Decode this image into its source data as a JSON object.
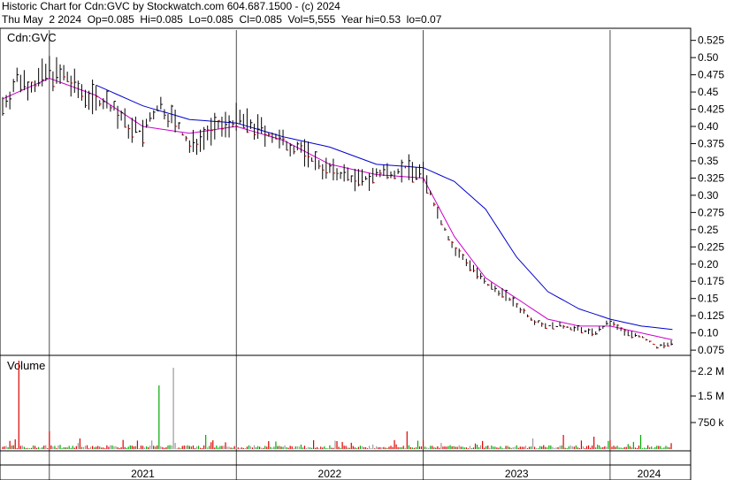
{
  "header": {
    "line1": "Historic Chart for Cdn:GVC by Stockwatch.com 604.687.1500 - (c) 2024",
    "line2": "Thu May  2 2024  Op=0.085  Hi=0.085  Lo=0.085  Cl=0.085  Vol=5,555  Year hi=0.53  lo=0.07"
  },
  "chart_data": [
    {
      "type": "ohlc",
      "title": "Cdn:GVC",
      "x_labels": [
        "2021",
        "2022",
        "2023",
        "2024"
      ],
      "x_range": [
        "2020-10",
        "2024-05"
      ],
      "ylim": [
        0.07,
        0.54
      ],
      "y_ticks": [
        "0.525",
        "0.50",
        "0.475",
        "0.45",
        "0.425",
        "0.40",
        "0.375",
        "0.35",
        "0.325",
        "0.30",
        "0.275",
        "0.25",
        "0.225",
        "0.20",
        "0.175",
        "0.15",
        "0.125",
        "0.10",
        "0.075"
      ],
      "grid": false,
      "colors": {
        "price_bar": "#000000",
        "down_tick": "#cc0000",
        "ma_short": "#cc00cc",
        "ma_long": "#0000cc"
      },
      "series": [
        {
          "name": "price",
          "values": [
            [
              "2020-10",
              0.43
            ],
            [
              "2020-11",
              0.47
            ],
            [
              "2020-12",
              0.46
            ],
            [
              "2021-01",
              0.48
            ],
            [
              "2021-02",
              0.47
            ],
            [
              "2021-03",
              0.45
            ],
            [
              "2021-04",
              0.44
            ],
            [
              "2021-05",
              0.43
            ],
            [
              "2021-06",
              0.4
            ],
            [
              "2021-07",
              0.39
            ],
            [
              "2021-08",
              0.43
            ],
            [
              "2021-09",
              0.41
            ],
            [
              "2021-10",
              0.37
            ],
            [
              "2021-11",
              0.39
            ],
            [
              "2021-12",
              0.4
            ],
            [
              "2022-01",
              0.41
            ],
            [
              "2022-02",
              0.4
            ],
            [
              "2022-03",
              0.39
            ],
            [
              "2022-04",
              0.375
            ],
            [
              "2022-05",
              0.37
            ],
            [
              "2022-06",
              0.35
            ],
            [
              "2022-07",
              0.335
            ],
            [
              "2022-08",
              0.33
            ],
            [
              "2022-09",
              0.32
            ],
            [
              "2022-10",
              0.33
            ],
            [
              "2022-11",
              0.335
            ],
            [
              "2022-12",
              0.34
            ],
            [
              "2023-01",
              0.33
            ],
            [
              "2023-02",
              0.27
            ],
            [
              "2023-03",
              0.22
            ],
            [
              "2023-04",
              0.2
            ],
            [
              "2023-05",
              0.17
            ],
            [
              "2023-06",
              0.16
            ],
            [
              "2023-07",
              0.14
            ],
            [
              "2023-08",
              0.12
            ],
            [
              "2023-09",
              0.11
            ],
            [
              "2023-10",
              0.11
            ],
            [
              "2023-11",
              0.105
            ],
            [
              "2023-12",
              0.1
            ],
            [
              "2024-01",
              0.115
            ],
            [
              "2024-02",
              0.1
            ],
            [
              "2024-03",
              0.095
            ],
            [
              "2024-04",
              0.08
            ],
            [
              "2024-05",
              0.085
            ]
          ]
        },
        {
          "name": "ma_short",
          "values": [
            [
              "2020-10",
              0.44
            ],
            [
              "2021-01",
              0.47
            ],
            [
              "2021-04",
              0.445
            ],
            [
              "2021-07",
              0.4
            ],
            [
              "2021-10",
              0.39
            ],
            [
              "2022-01",
              0.4
            ],
            [
              "2022-04",
              0.38
            ],
            [
              "2022-07",
              0.345
            ],
            [
              "2022-10",
              0.33
            ],
            [
              "2023-01",
              0.325
            ],
            [
              "2023-03",
              0.24
            ],
            [
              "2023-05",
              0.18
            ],
            [
              "2023-07",
              0.15
            ],
            [
              "2023-09",
              0.12
            ],
            [
              "2023-11",
              0.11
            ],
            [
              "2024-01",
              0.11
            ],
            [
              "2024-03",
              0.1
            ],
            [
              "2024-05",
              0.09
            ]
          ]
        },
        {
          "name": "ma_long",
          "values": [
            [
              "2021-04",
              0.46
            ],
            [
              "2021-07",
              0.43
            ],
            [
              "2021-10",
              0.41
            ],
            [
              "2022-01",
              0.405
            ],
            [
              "2022-04",
              0.385
            ],
            [
              "2022-07",
              0.37
            ],
            [
              "2022-10",
              0.345
            ],
            [
              "2023-01",
              0.34
            ],
            [
              "2023-03",
              0.32
            ],
            [
              "2023-05",
              0.28
            ],
            [
              "2023-07",
              0.21
            ],
            [
              "2023-09",
              0.16
            ],
            [
              "2023-11",
              0.135
            ],
            [
              "2024-01",
              0.12
            ],
            [
              "2024-03",
              0.11
            ],
            [
              "2024-05",
              0.105
            ]
          ]
        }
      ]
    },
    {
      "type": "bar",
      "title": "Volume",
      "y_ticks": [
        "2.2 M",
        "1.5 M",
        "750 k"
      ],
      "ylim": [
        0,
        2600000
      ],
      "colors": {
        "up": "#00aa00",
        "down": "#dd0000",
        "flat": "#999999"
      },
      "series": [
        {
          "name": "volume",
          "values": [
            [
              "2020-11",
              2500000
            ],
            [
              "2021-01",
              500000
            ],
            [
              "2021-03",
              300000
            ],
            [
              "2021-08",
              1800000
            ],
            [
              "2021-09",
              2300000
            ],
            [
              "2021-11",
              400000
            ],
            [
              "2022-06",
              250000
            ],
            [
              "2022-12",
              500000
            ],
            [
              "2023-01",
              250000
            ],
            [
              "2023-08",
              300000
            ],
            [
              "2023-10",
              400000
            ],
            [
              "2023-12",
              350000
            ],
            [
              "2024-01",
              250000
            ],
            [
              "2024-03",
              400000
            ]
          ]
        }
      ]
    }
  ]
}
